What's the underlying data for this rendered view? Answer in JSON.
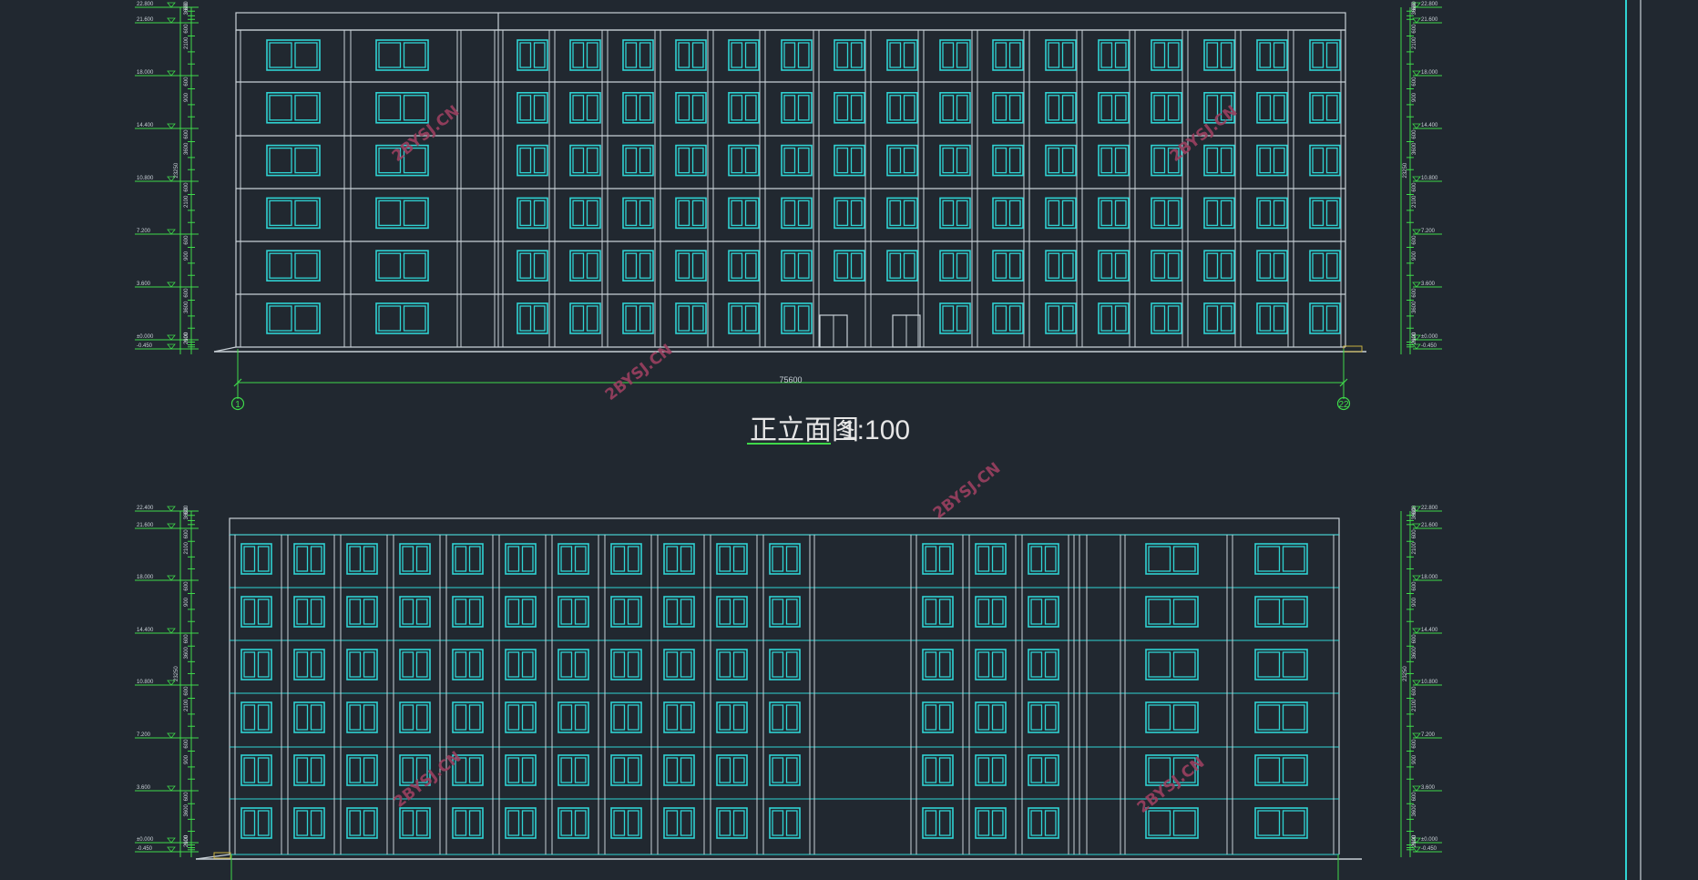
{
  "drawing": {
    "title_main": "正立面图",
    "title_scale": "1:100",
    "total_dim": "75600",
    "axis_start": "1",
    "axis_end": "22",
    "watermark": "2BYSJ.CN"
  },
  "colors": {
    "background": "#212830",
    "cyan": "#2fd3d3",
    "white": "#c8d0d6",
    "green": "#3fd94a",
    "title": "#e6e6e6",
    "watermark": "#9c4060",
    "yellow": "#c8b040"
  },
  "elevation_top": {
    "left_levels": [
      "22.800",
      "21.600",
      "18.000",
      "14.400",
      "10.800",
      "7.200",
      "3.600",
      "±0.000",
      "-0.450"
    ],
    "right_levels": [
      "22.800",
      "21.600",
      "18.000",
      "14.400",
      "10.800",
      "7.200",
      "3.600",
      "±0.000",
      "-0.450"
    ],
    "dim_labels": [
      "1200",
      "600",
      "3600",
      "2100",
      "900",
      "23250",
      "450"
    ],
    "floors": 6
  },
  "elevation_bottom": {
    "left_levels": [
      "22.400",
      "21.600",
      "18.000",
      "14.400",
      "10.800",
      "7.200",
      "3.600",
      "±0.000",
      "-0.450"
    ],
    "right_levels": [
      "22.800",
      "21.600",
      "18.000",
      "14.400",
      "10.800",
      "7.200",
      "3.600",
      "±0.000",
      "-0.450"
    ],
    "dim_labels": [
      "1200",
      "600",
      "3600",
      "2100",
      "900",
      "23250",
      "450"
    ],
    "floors": 6
  }
}
